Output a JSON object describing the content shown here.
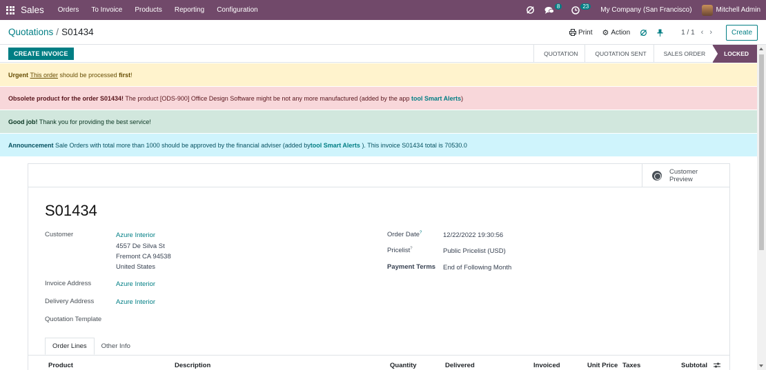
{
  "topbar": {
    "app_name": "Sales",
    "menu": [
      "Orders",
      "To Invoice",
      "Products",
      "Reporting",
      "Configuration"
    ],
    "chat_count": "8",
    "activity_count": "23",
    "company": "My Company (San Francisco)",
    "user": "Mitchell Admin",
    "bg_color": "#71496a"
  },
  "control": {
    "breadcrumb_parent": "Quotations",
    "breadcrumb_current": "S01434",
    "print_label": "Print",
    "action_label": "Action",
    "pager": "1 / 1",
    "create_label": "Create"
  },
  "statusbar": {
    "invoice_button": "CREATE INVOICE",
    "stages": [
      "QUOTATION",
      "QUOTATION SENT",
      "SALES ORDER",
      "LOCKED"
    ],
    "active_stage": "LOCKED"
  },
  "alerts": {
    "warning": {
      "title": "Urgent",
      "link": "This order",
      "mid": " should be processed ",
      "strong": "first",
      "end": "!"
    },
    "danger": {
      "title": "Obsolete product for the order S01434!",
      "text": " The product [ODS-900] Office Design Software might be not any more manufactured (added by the app ",
      "link": "tool Smart Alerts",
      "end": ")"
    },
    "success": {
      "title": "Good job!",
      "text": " Thank you for providing the best service!"
    },
    "info": {
      "title": "Announcement",
      "text": " Sale Orders with total more than 1000 should be approved by the financial adviser (added by",
      "link": "tool Smart Alerts",
      "end": " ). This invoice S01434 total is 70530.0"
    }
  },
  "form": {
    "preview_line1": "Customer",
    "preview_line2": "Preview",
    "order_name": "S01434",
    "customer_label": "Customer",
    "customer_name": "Azure Interior",
    "address_line1": "4557 De Silva St",
    "address_line2": "Fremont CA 94538",
    "address_line3": "United States",
    "invoice_address_label": "Invoice Address",
    "invoice_address": "Azure Interior",
    "delivery_address_label": "Delivery Address",
    "delivery_address": "Azure Interior",
    "template_label": "Quotation Template",
    "order_date_label": "Order Date",
    "order_date": "12/22/2022 19:30:56",
    "pricelist_label": "Pricelist",
    "pricelist": "Public Pricelist (USD)",
    "payment_terms_label": "Payment Terms",
    "payment_terms": "End of Following Month",
    "tabs": [
      "Order Lines",
      "Other Info"
    ],
    "columns": [
      "Product",
      "Description",
      "Quantity",
      "Delivered",
      "Invoiced",
      "Unit Price",
      "Taxes",
      "Subtotal"
    ]
  }
}
